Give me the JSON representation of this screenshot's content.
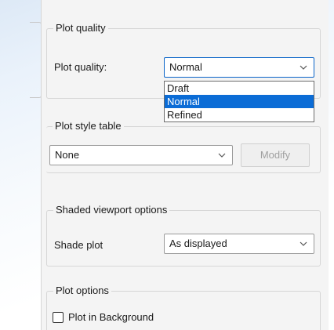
{
  "plot_quality_group": {
    "title": "Plot quality",
    "label": "Plot quality:",
    "selected": "Normal",
    "options": [
      "Draft",
      "Normal",
      "Refined"
    ],
    "highlighted_option": "Normal"
  },
  "plot_style_group": {
    "title": "Plot style table",
    "selected": "None",
    "modify_label": "Modify"
  },
  "shaded_group": {
    "title": "Shaded viewport options",
    "label": "Shade plot",
    "selected": "As displayed"
  },
  "plot_options_group": {
    "title": "Plot options",
    "checkbox_label": "Plot in Background",
    "checked": false
  },
  "colors": {
    "selection": "#0b6cd6",
    "focus_border": "#0a64c8",
    "panel_bg": "#f4f4f4"
  }
}
